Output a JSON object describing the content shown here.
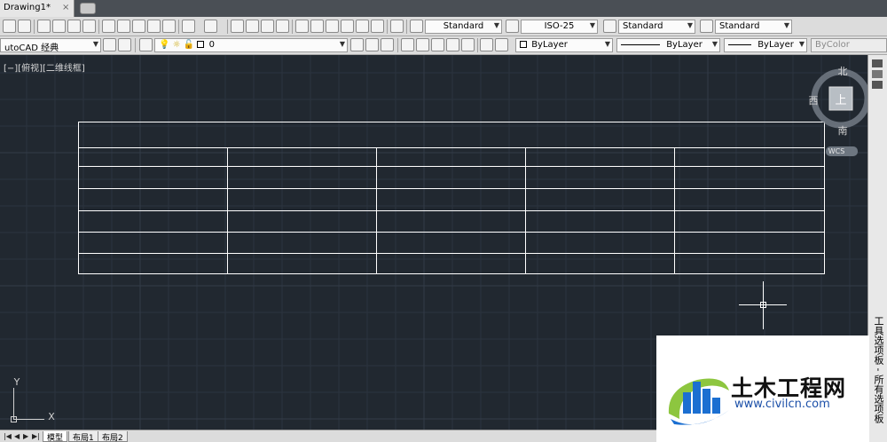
{
  "document": {
    "tab_title": "Drawing1*",
    "close_glyph": "×"
  },
  "toolbar_styles": {
    "text_style": "Standard",
    "dim_style": "ISO-25",
    "table_style": "Standard",
    "mleader_style": "Standard"
  },
  "toolbar_layers": {
    "workspace": "utoCAD 经典",
    "current_layer": "0",
    "color": "ByLayer",
    "linetype": "ByLayer",
    "lineweight": "ByLayer",
    "plotstyle": "ByColor"
  },
  "viewport": {
    "label": "[−][俯视][二维线框]"
  },
  "viewcube": {
    "north": "北",
    "west": "西",
    "south": "南",
    "top_face": "上",
    "ucs": "WCS"
  },
  "ucs_icon": {
    "x": "X",
    "y": "Y"
  },
  "layout_tabs": [
    "模型",
    "布局1",
    "布局2"
  ],
  "tool_palette": {
    "label": "工具选项板 - 所有选项板"
  },
  "watermark": {
    "name": "土木工程网",
    "url": "www.civilcn.com"
  },
  "colors": {
    "canvas_bg": "#212830",
    "grid_line": "#2d3540",
    "table_line": "#ffffff",
    "logo_blue": "#1b6fd1",
    "logo_green": "#8dc63f"
  }
}
